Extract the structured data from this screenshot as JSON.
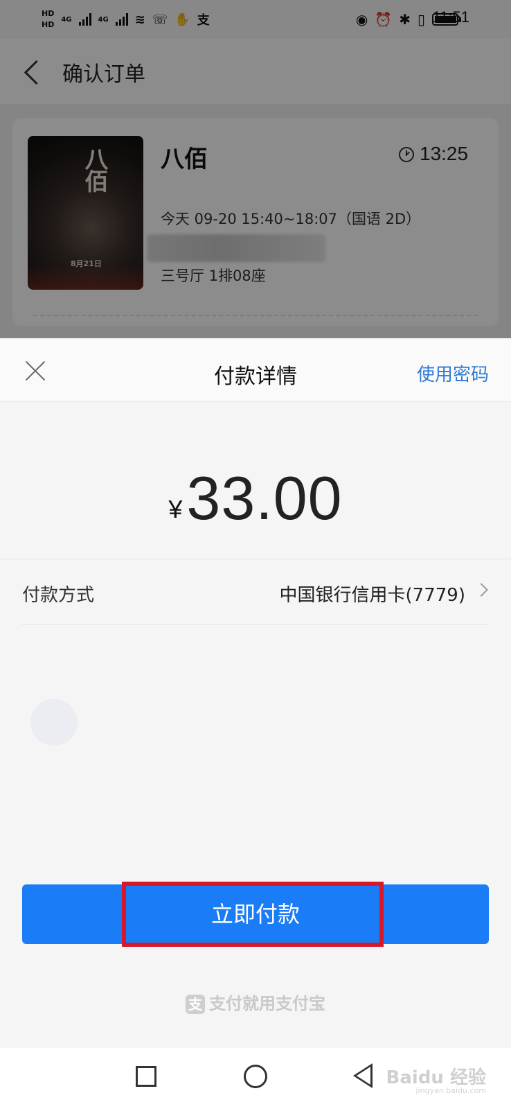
{
  "status_bar": {
    "hd1": "HD",
    "hd2": "HD",
    "net1": "4G",
    "net2": "4G",
    "time": "11:51",
    "battery_level": 0.9
  },
  "order_page": {
    "title": "确认订单",
    "movie": {
      "name": "八佰",
      "countdown": "13:25",
      "showtime": "今天 09-20 15:40~18:07（国语 2D）",
      "seat": "三号厅 1排08座"
    }
  },
  "payment_sheet": {
    "title": "付款详情",
    "use_password": "使用密码",
    "currency": "¥",
    "amount": "33.00",
    "method_label": "付款方式",
    "method_value": "中国银行信用卡(7779)",
    "pay_button": "立即付款",
    "brand": "支付就用支付宝"
  },
  "nav_bar": {
    "watermark": "Baidu 经验",
    "watermark_sub": "jingyan.baidu.com"
  }
}
